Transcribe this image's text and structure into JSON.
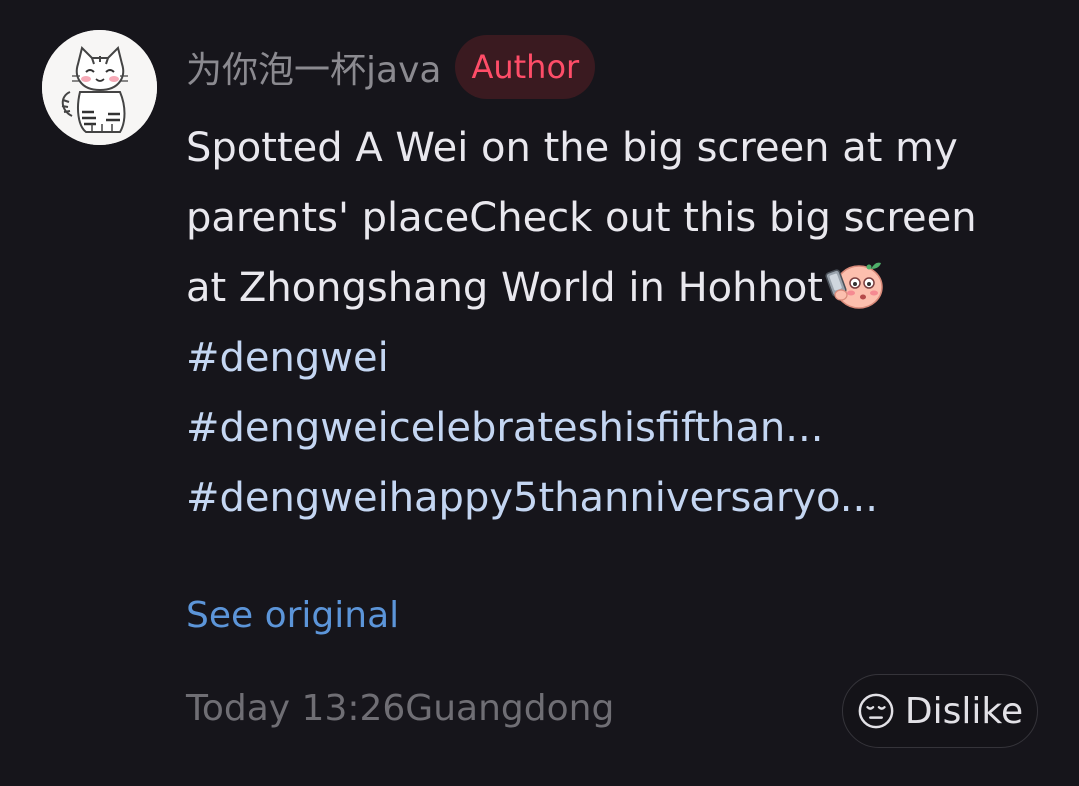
{
  "comment": {
    "username": "为你泡一杯java",
    "badge": "Author",
    "text_lines": [
      "Spotted A Wei on the big screen at my",
      "parents' placeCheck out this big screen",
      "at Zhongshang World in Hohhot"
    ],
    "emoji": "phone-selfie-emoji",
    "hashtags": [
      "#dengwei",
      "#dengweicelebrateshisfifthan...",
      "#dengweihappy5thanniversaryo..."
    ],
    "see_original": "See original",
    "timestamp_location": "Today 13:26Guangdong",
    "dislike_label": "Dislike"
  },
  "colors": {
    "background": "#16151b",
    "badge_text": "#ff4d68",
    "link": "#5c95d9",
    "hashtag": "#c4d6f2"
  }
}
